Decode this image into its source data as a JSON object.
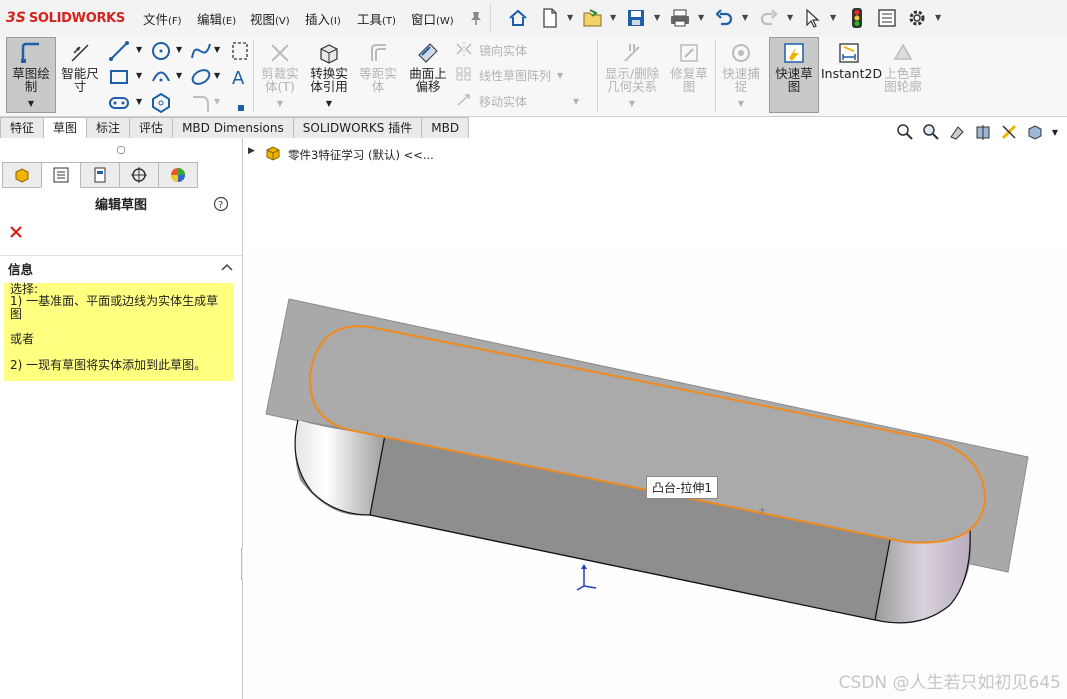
{
  "app": {
    "logo_ds": "3S",
    "logo_text": "SOLIDWORKS"
  },
  "menus": [
    {
      "label": "文件",
      "key": "(F)"
    },
    {
      "label": "编辑",
      "key": "(E)"
    },
    {
      "label": "视图",
      "key": "(V)"
    },
    {
      "label": "插入",
      "key": "(I)"
    },
    {
      "label": "工具",
      "key": "(T)"
    },
    {
      "label": "窗口",
      "key": "(W)"
    }
  ],
  "ribbon": {
    "sketch_draw": "草图绘\n制",
    "smart_dim": "智能尺\n寸",
    "trim": "剪裁实\n体(T)",
    "convert": "转换实\n体引用",
    "offset": "等距实\n体",
    "surface_offset": "曲面上\n偏移",
    "mirror": "镜向实体",
    "linear_pattern": "线性草图阵列",
    "move": "移动实体",
    "show_delete": "显示/删除\n几何关系",
    "repair": "修复草\n图",
    "quick_snap": "快速捕\n捉",
    "rapid_sketch": "快速草\n图",
    "instant2d": "Instant2D",
    "shaded_contours": "上色草\n图轮廓"
  },
  "tabs": [
    "特征",
    "草图",
    "标注",
    "评估",
    "MBD Dimensions",
    "SOLIDWORKS 插件",
    "MBD"
  ],
  "active_tab": 1,
  "panel": {
    "title": "编辑草图",
    "section_title": "信息",
    "info_line1": "选择:",
    "info_line2": "1) 一基准面、平面或边线为实体生成草图",
    "info_line3": "或者",
    "info_line4": "2) 一现有草图将实体添加到此草图。"
  },
  "tree": {
    "part_name": "零件3特征学习 (默认) <<..."
  },
  "viewport": {
    "tooltip": "凸台-拉伸1"
  },
  "watermark": "CSDN @人生若只如初见645",
  "colors": {
    "accent_orange": "#f08a1c",
    "info_yellow": "#ffff80",
    "logo_red": "#d6221c",
    "selected_gray": "#c9c9c9"
  }
}
